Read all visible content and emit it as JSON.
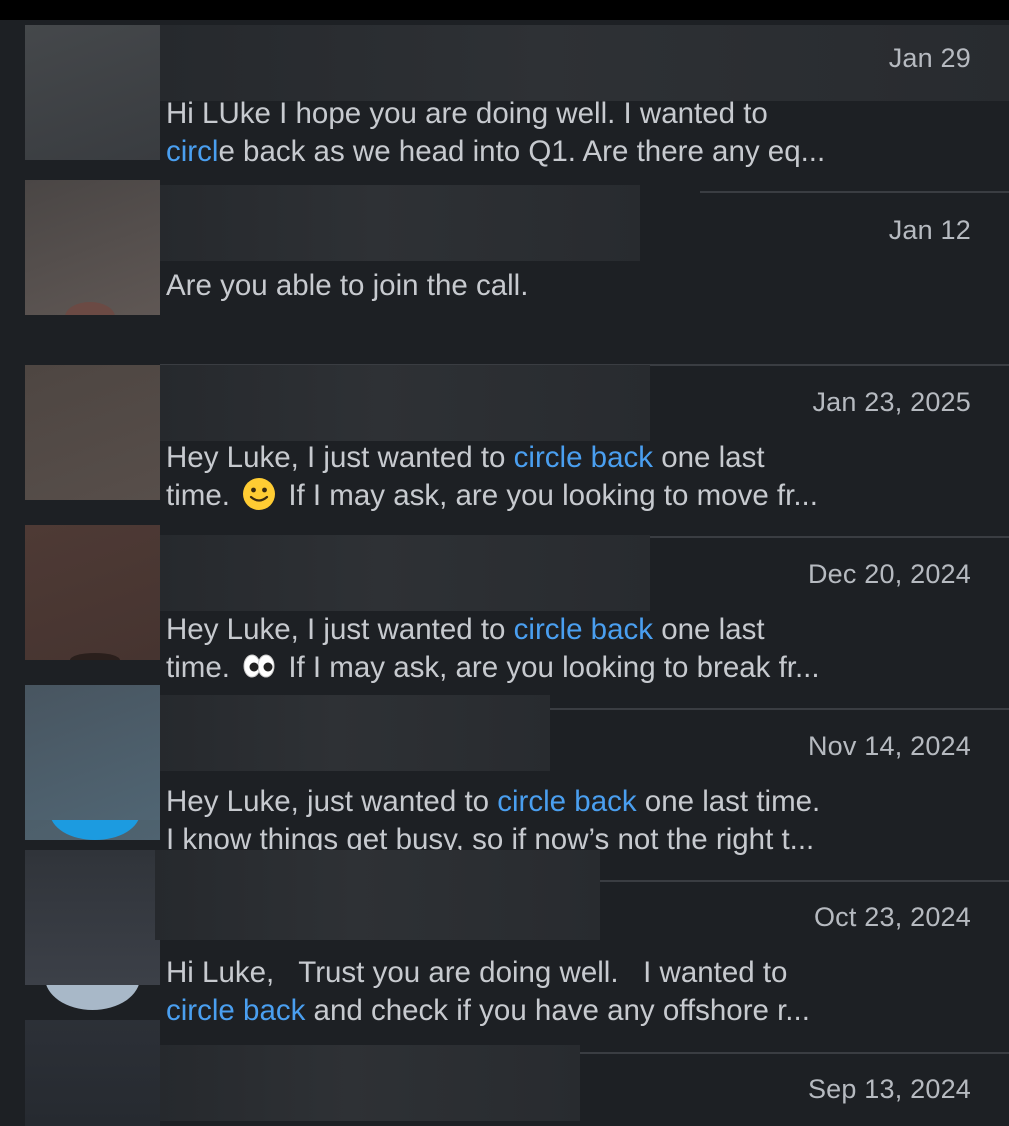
{
  "conversations": [
    {
      "date": "Jan 29",
      "line1": {
        "pre": "Hi LUke I hope you are doing well. I wanted to",
        "hl": "",
        "post": ""
      },
      "line2": {
        "pre": "",
        "hl": "circl",
        "post": "e back as we head into Q1. Are there any eq..."
      },
      "avatar_color": "#3e4144"
    },
    {
      "date": "Jan 12",
      "line1": {
        "pre": "Are you able to join the call.",
        "hl": "",
        "post": ""
      },
      "line2": {
        "pre": "",
        "hl": "",
        "post": ""
      },
      "avatar_color": "#5a5350"
    },
    {
      "date": "Jan 23, 2025",
      "line1": {
        "pre": "Hey Luke, I just wanted to ",
        "hl": "circle back",
        "post": " one last"
      },
      "line2": {
        "pre": "time. ",
        "emoji": "slightly-smiling-face",
        "hl": "",
        "post": " If I may ask, are you looking to move fr..."
      },
      "avatar_color": "#524a46"
    },
    {
      "date": "Dec 20, 2024",
      "line1": {
        "pre": "Hey Luke, I just wanted to ",
        "hl": "circle back",
        "post": " one last"
      },
      "line2": {
        "pre": "time. ",
        "emoji": "eyes",
        "hl": "",
        "post": " If I may ask, are you looking to break fr..."
      },
      "avatar_color": "#4a3834"
    },
    {
      "date": "Nov 14, 2024",
      "line1": {
        "pre": "Hey Luke, just wanted to ",
        "hl": "circle back",
        "post": " one last time."
      },
      "line2": {
        "pre": "I know things get busy, so if now’s not the right t...",
        "hl": "",
        "post": ""
      },
      "avatar_color": "#4a5c66"
    },
    {
      "date": "Oct 23, 2024",
      "line1": {
        "pre": "Hi Luke,   Trust you are doing well.   I wanted to",
        "hl": "",
        "post": ""
      },
      "line2": {
        "pre": "",
        "hl": "circle back",
        "post": " and check if you have any offshore r..."
      },
      "avatar_color": "#363b43"
    },
    {
      "date": "Sep 13, 2024",
      "line1": {
        "pre": "",
        "hl": "",
        "post": ""
      },
      "line2": {
        "pre": "",
        "hl": "",
        "post": ""
      },
      "avatar_color": "#2a2e34"
    }
  ],
  "colors": {
    "background": "#1d2024",
    "highlight": "#4a9ff0",
    "text": "#c7cacf",
    "date": "#b6bac0"
  }
}
